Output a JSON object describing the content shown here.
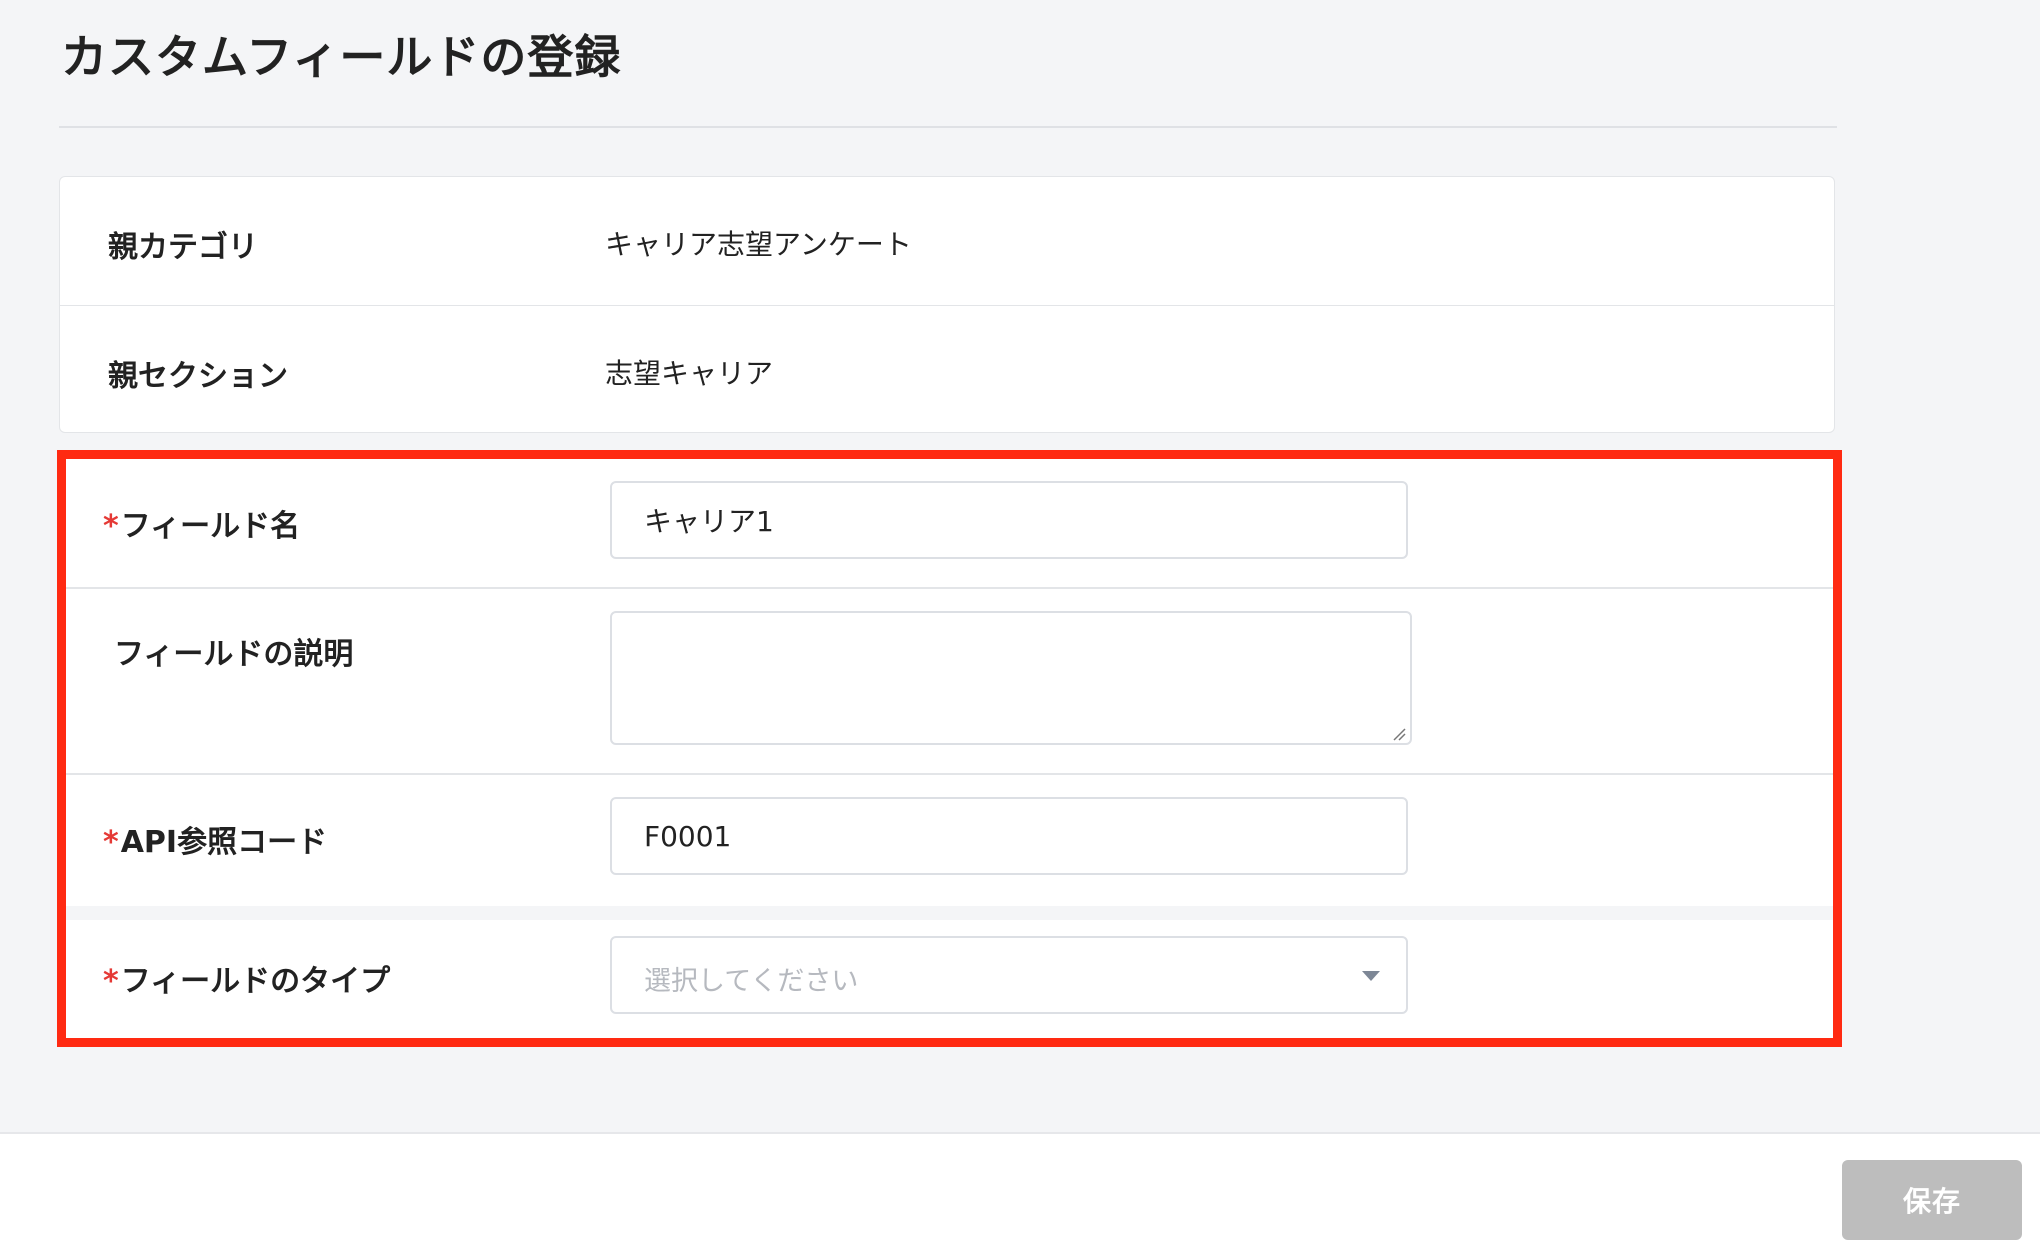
{
  "page": {
    "title": "カスタムフィールドの登録"
  },
  "info": {
    "parent_category_label": "親カテゴリ",
    "parent_category_value": "キャリア志望アンケート",
    "parent_section_label": "親セクション",
    "parent_section_value": "志望キャリア"
  },
  "form": {
    "required_mark": "*",
    "field_name_label": "フィールド名",
    "field_name_value": "キャリア1",
    "field_description_label": "フィールドの説明",
    "field_description_value": "",
    "api_code_label": "API参照コード",
    "api_code_value": "F0001",
    "field_type_label": "フィールドのタイプ",
    "field_type_placeholder": "選択してください"
  },
  "footer": {
    "save_label": "保存"
  },
  "colors": {
    "highlight_border": "#ff2a12",
    "required_mark": "#e53935",
    "save_button_disabled": "#bdbdbd"
  },
  "icons": {
    "select_caret": "caret-down-icon",
    "textarea_resize": "resize-handle-icon"
  }
}
